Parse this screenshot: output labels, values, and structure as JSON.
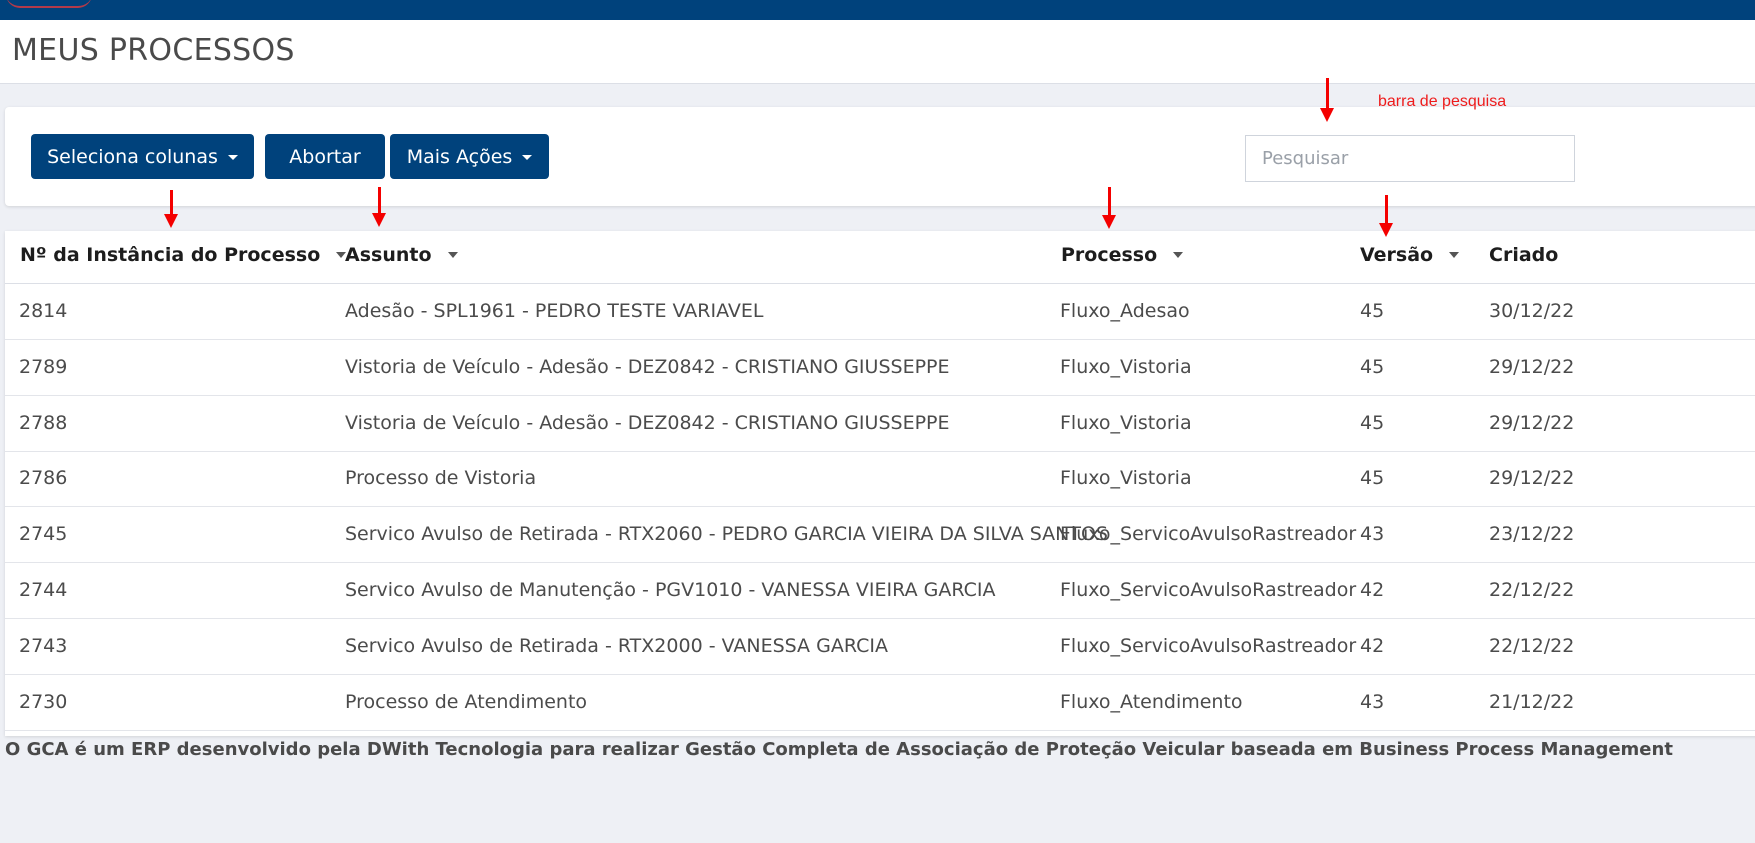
{
  "page": {
    "title": "MEUS PROCESSOS"
  },
  "toolbar": {
    "select_columns_label": "Seleciona colunas",
    "abort_label": "Abortar",
    "more_actions_label": "Mais Ações",
    "search_placeholder": "Pesquisar",
    "search_value": ""
  },
  "annotation": {
    "search_label": "barra de pesquisa"
  },
  "table": {
    "columns": [
      "Nº da Instância do Processo",
      "Assunto",
      "Processo",
      "Versão",
      "Criado"
    ],
    "rows": [
      [
        "2814",
        "Adesão - SPL1961 - PEDRO TESTE VARIAVEL",
        "Fluxo_Adesao",
        "45",
        "30/12/22"
      ],
      [
        "2789",
        "Vistoria de Veículo - Adesão - DEZ0842 - CRISTIANO GIUSSEPPE",
        "Fluxo_Vistoria",
        "45",
        "29/12/22"
      ],
      [
        "2788",
        "Vistoria de Veículo - Adesão - DEZ0842 - CRISTIANO GIUSSEPPE",
        "Fluxo_Vistoria",
        "45",
        "29/12/22"
      ],
      [
        "2786",
        "Processo de Vistoria",
        "Fluxo_Vistoria",
        "45",
        "29/12/22"
      ],
      [
        "2745",
        "Servico Avulso de Retirada - RTX2060 - PEDRO GARCIA VIEIRA DA SILVA SANTOS",
        "Fluxo_ServicoAvulsoRastreador",
        "43",
        "23/12/22"
      ],
      [
        "2744",
        "Servico Avulso de Manutenção - PGV1010 - VANESSA VIEIRA GARCIA",
        "Fluxo_ServicoAvulsoRastreador",
        "42",
        "22/12/22"
      ],
      [
        "2743",
        "Servico Avulso de Retirada - RTX2000 - VANESSA GARCIA",
        "Fluxo_ServicoAvulsoRastreador",
        "42",
        "22/12/22"
      ],
      [
        "2730",
        "Processo de Atendimento",
        "Fluxo_Atendimento",
        "43",
        "21/12/22"
      ]
    ]
  },
  "footer": {
    "text": "O GCA é um ERP desenvolvido pela DWith Tecnologia para realizar Gestão Completa de Associação de Proteção Veicular baseada em Business Process Management"
  },
  "colors": {
    "primary": "#00427c",
    "annotation": "#f40000",
    "background": "#eef0f5"
  }
}
